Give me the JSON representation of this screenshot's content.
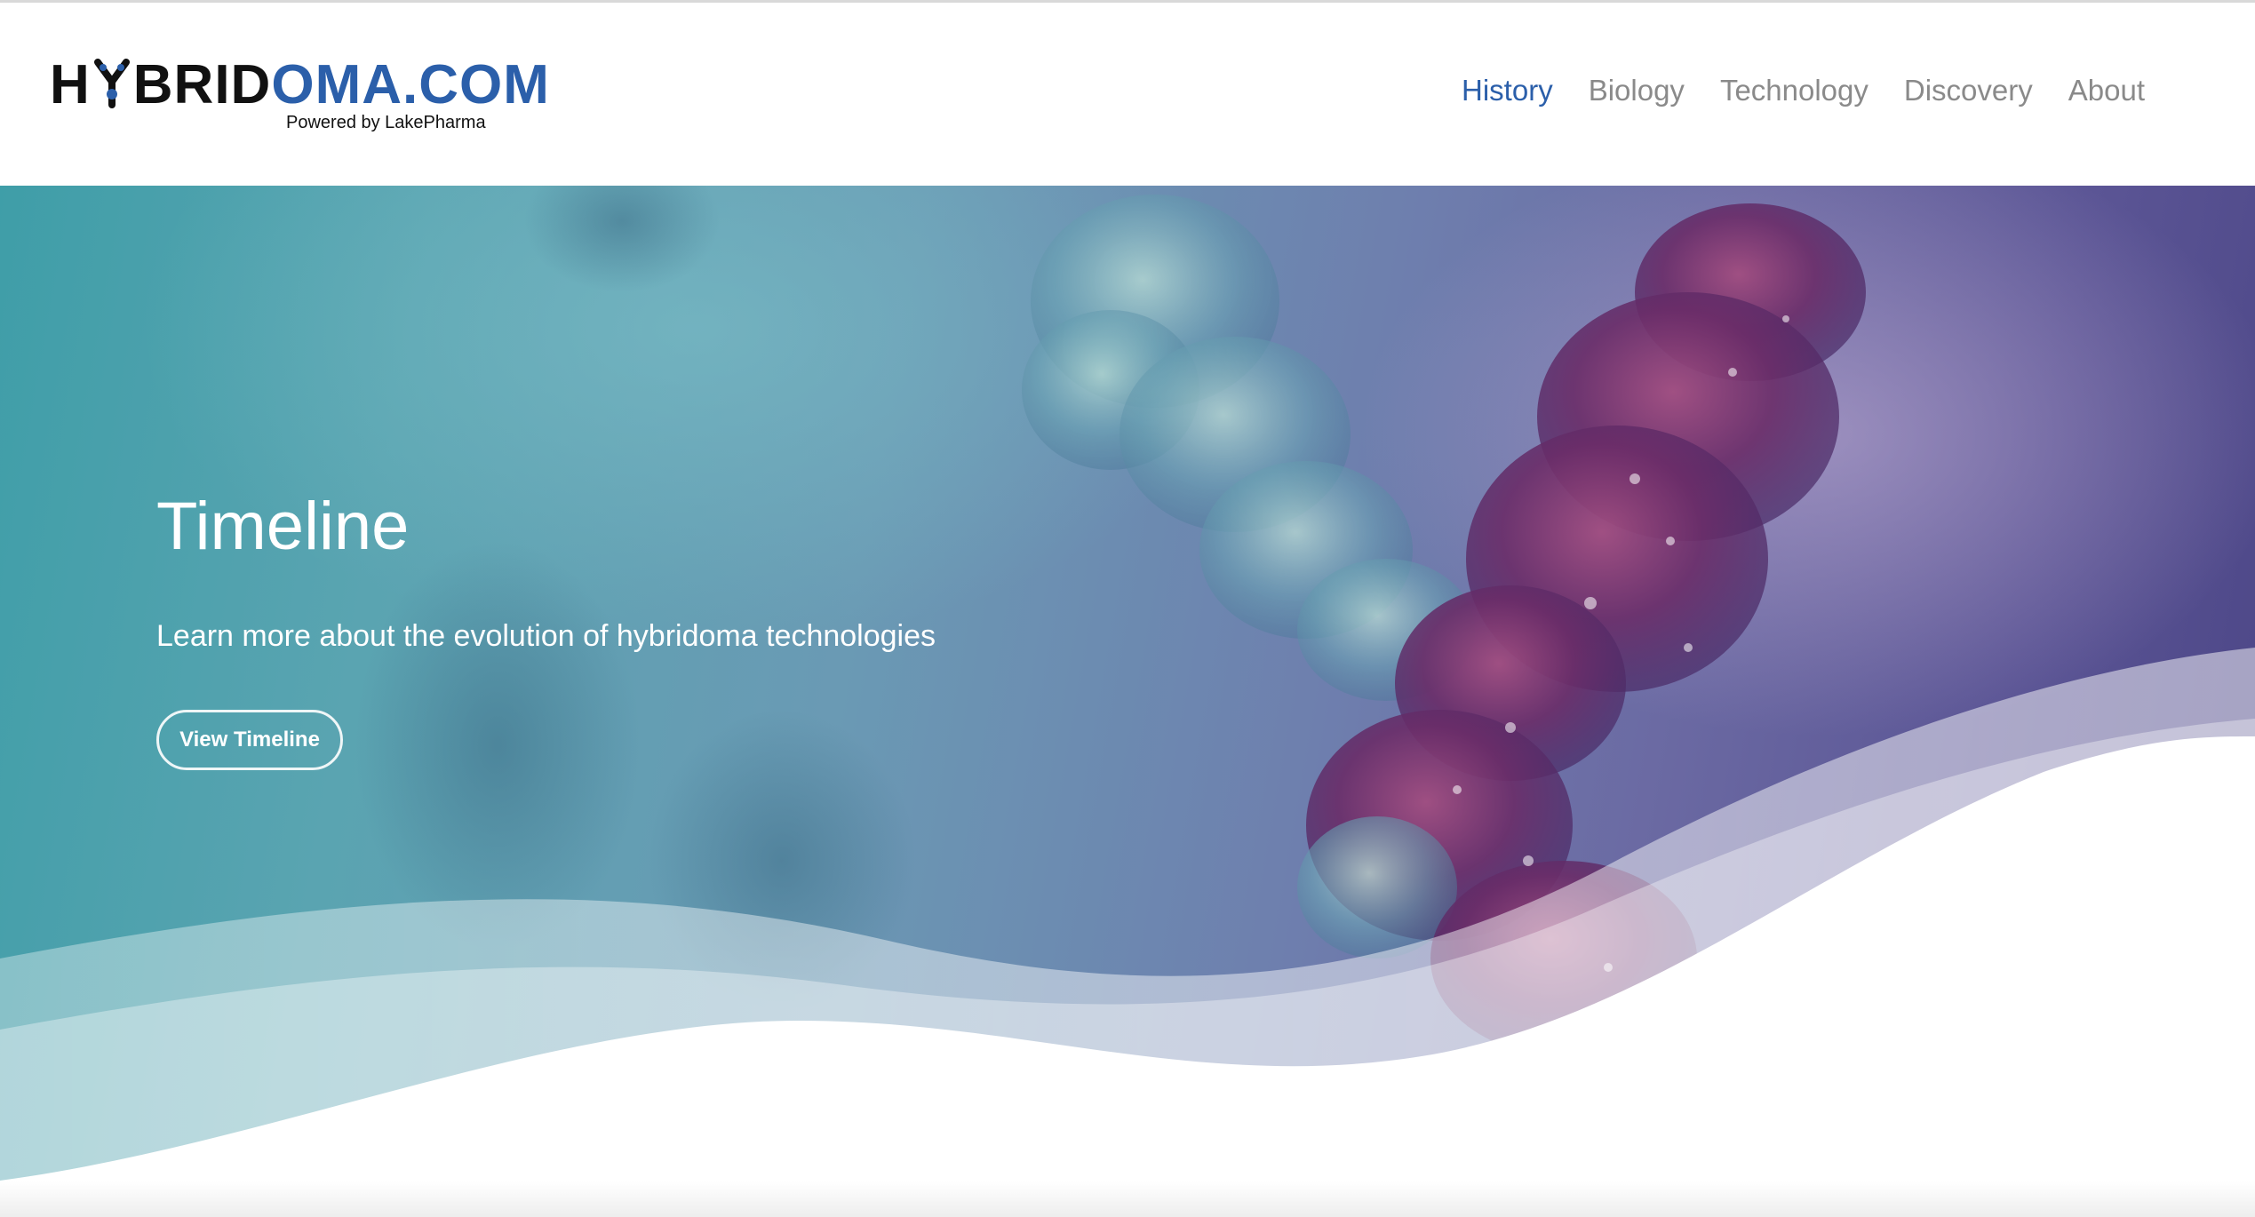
{
  "brand": {
    "logo_left": "H",
    "logo_mid": "BRID",
    "logo_right": "OMA.COM",
    "tagline": "Powered by LakePharma",
    "dark_color": "#111111",
    "accent_color": "#2b5faa"
  },
  "nav": {
    "items": [
      {
        "label": "History",
        "active": true
      },
      {
        "label": "Biology",
        "active": false
      },
      {
        "label": "Technology",
        "active": false
      },
      {
        "label": "Discovery",
        "active": false
      },
      {
        "label": "About",
        "active": false
      }
    ]
  },
  "hero": {
    "title": "Timeline",
    "subtitle": "Learn more about the evolution of hybridoma technologies",
    "button_label": "View Timeline",
    "background_image": "antibody-molecule-illustration"
  }
}
